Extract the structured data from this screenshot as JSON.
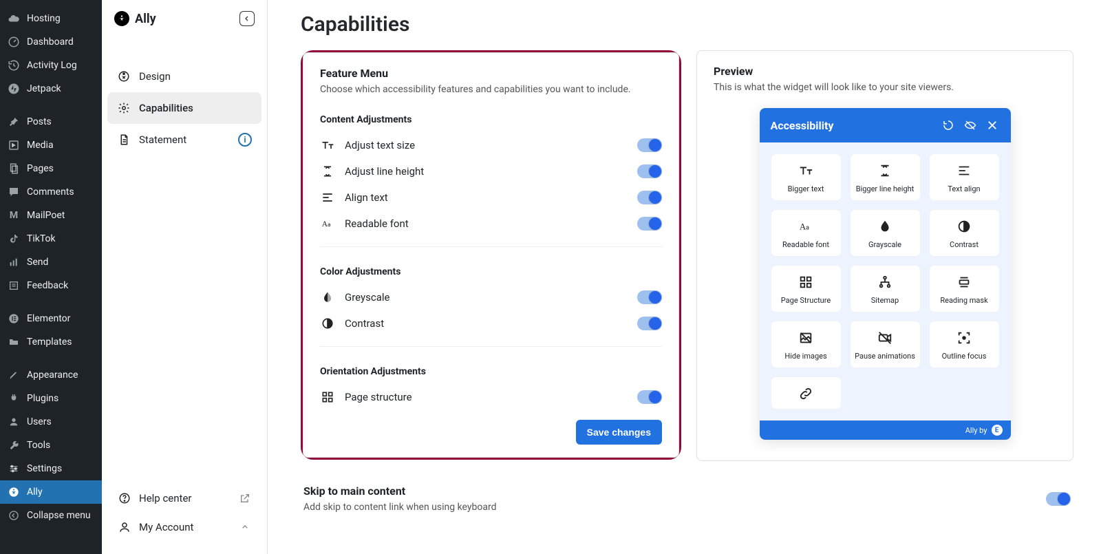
{
  "wp_sidebar": {
    "items": [
      {
        "label": "Hosting"
      },
      {
        "label": "Dashboard"
      },
      {
        "label": "Activity Log"
      },
      {
        "label": "Jetpack"
      },
      {
        "label": "Posts"
      },
      {
        "label": "Media"
      },
      {
        "label": "Pages"
      },
      {
        "label": "Comments"
      },
      {
        "label": "MailPoet"
      },
      {
        "label": "TikTok"
      },
      {
        "label": "Send"
      },
      {
        "label": "Feedback"
      },
      {
        "label": "Elementor"
      },
      {
        "label": "Templates"
      },
      {
        "label": "Appearance"
      },
      {
        "label": "Plugins"
      },
      {
        "label": "Users"
      },
      {
        "label": "Tools"
      },
      {
        "label": "Settings"
      },
      {
        "label": "Ally"
      },
      {
        "label": "Collapse menu"
      }
    ]
  },
  "ally": {
    "brand": "Ally",
    "nav": {
      "design": "Design",
      "capabilities": "Capabilities",
      "statement": "Statement"
    },
    "help": "Help center",
    "account": "My Account"
  },
  "page": {
    "title": "Capabilities"
  },
  "feature": {
    "title": "Feature Menu",
    "desc": "Choose which accessibility features and capabilities you want to include.",
    "groups": {
      "content": "Content Adjustments",
      "color": "Color Adjustments",
      "orientation": "Orientation Adjustments"
    },
    "items": {
      "text_size": "Adjust text size",
      "line_height": "Adjust line height",
      "align": "Align text",
      "readable": "Readable font",
      "grey": "Greyscale",
      "contrast": "Contrast",
      "structure": "Page structure"
    },
    "save": "Save changes"
  },
  "preview": {
    "title": "Preview",
    "desc": "This is what the widget will look like to your site viewers.",
    "widget_title": "Accessibility",
    "tiles": {
      "bigger_text": "Bigger text",
      "bigger_line": "Bigger line height",
      "text_align": "Text align",
      "readable": "Readable font",
      "grayscale": "Grayscale",
      "contrast": "Contrast",
      "page_structure": "Page Structure",
      "sitemap": "Sitemap",
      "reading_mask": "Reading mask",
      "hide_images": "Hide images",
      "pause_anim": "Pause animations",
      "outline_focus": "Outline focus"
    },
    "footer": "Ally by"
  },
  "skip": {
    "title": "Skip to main content",
    "desc": "Add skip to content link when using keyboard"
  }
}
